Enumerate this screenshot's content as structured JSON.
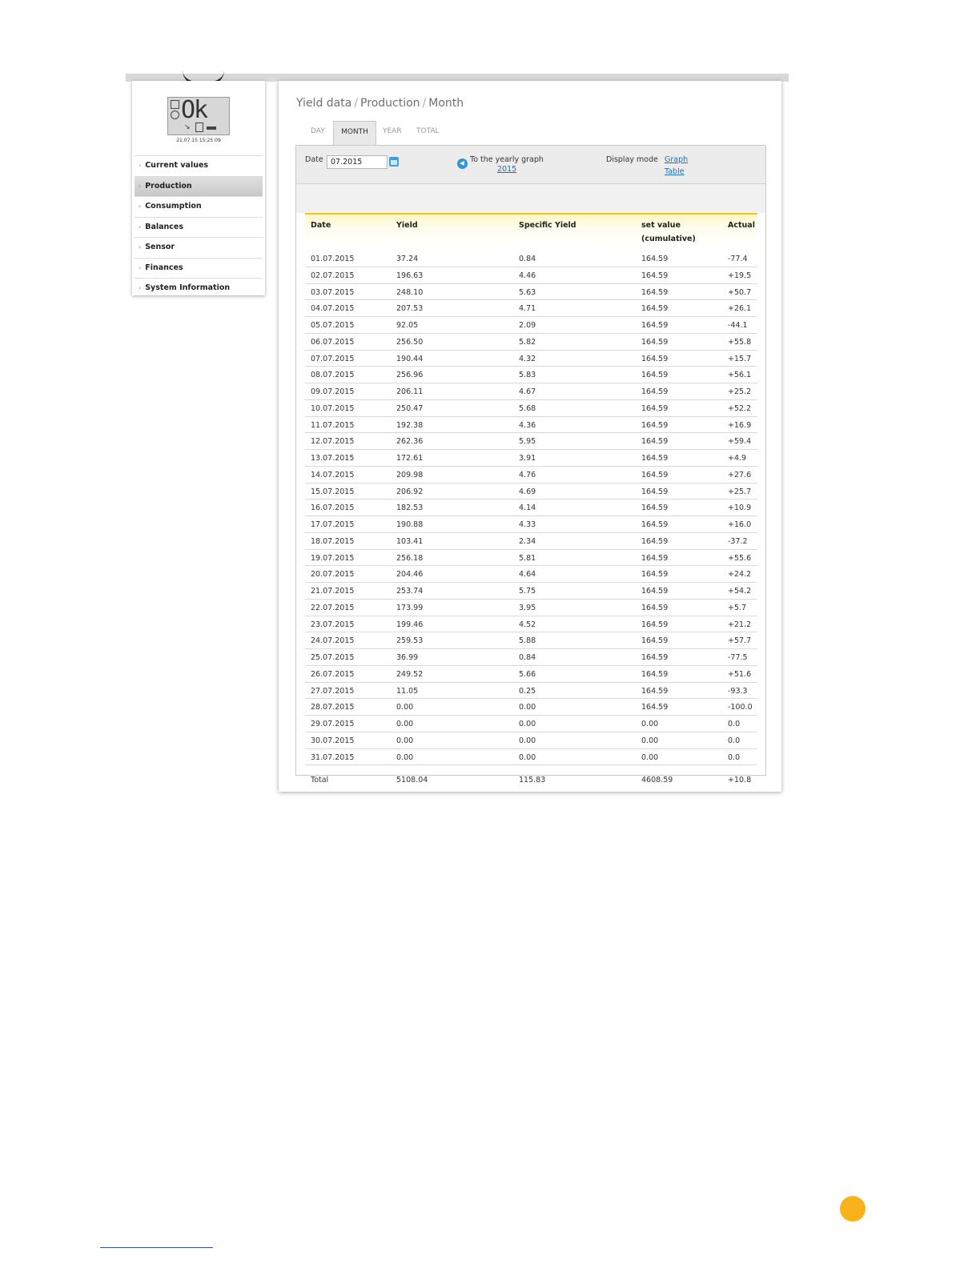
{
  "sidebar": {
    "display_text": "Ok",
    "timestamp": "21.07.15 15:25:09",
    "menu": [
      {
        "label": "Current values"
      },
      {
        "label": "Production",
        "active": true
      },
      {
        "label": "Consumption"
      },
      {
        "label": "Balances"
      },
      {
        "label": "Sensor"
      },
      {
        "label": "Finances"
      },
      {
        "label": "System Information"
      }
    ]
  },
  "main": {
    "breadcrumb": [
      "Yield data",
      "Production",
      "Month"
    ],
    "tabs": [
      {
        "label": "DAY"
      },
      {
        "label": "MONTH",
        "active": true
      },
      {
        "label": "YEAR"
      },
      {
        "label": "TOTAL"
      }
    ],
    "toolbar": {
      "date_label": "Date",
      "date_value": "07.2015",
      "yearly_link_text": "To the yearly graph",
      "yearly_link_year": "2015",
      "display_mode_label": "Display mode",
      "mode_graph": "Graph",
      "mode_table": "Table"
    },
    "table": {
      "headers": [
        "Date",
        "Yield",
        "Specific Yield",
        "set value",
        "Actual"
      ],
      "header_sub": "(cumulative)",
      "rows": [
        [
          "01.07.2015",
          "37.24",
          "0.84",
          "164.59",
          "-77.4"
        ],
        [
          "02.07.2015",
          "196.63",
          "4.46",
          "164.59",
          "+19.5"
        ],
        [
          "03.07.2015",
          "248.10",
          "5.63",
          "164.59",
          "+50.7"
        ],
        [
          "04.07.2015",
          "207.53",
          "4.71",
          "164.59",
          "+26.1"
        ],
        [
          "05.07.2015",
          "92.05",
          "2.09",
          "164.59",
          "-44.1"
        ],
        [
          "06.07.2015",
          "256.50",
          "5.82",
          "164.59",
          "+55.8"
        ],
        [
          "07.07.2015",
          "190.44",
          "4.32",
          "164.59",
          "+15.7"
        ],
        [
          "08.07.2015",
          "256.96",
          "5.83",
          "164.59",
          "+56.1"
        ],
        [
          "09.07.2015",
          "206.11",
          "4.67",
          "164.59",
          "+25.2"
        ],
        [
          "10.07.2015",
          "250.47",
          "5.68",
          "164.59",
          "+52.2"
        ],
        [
          "11.07.2015",
          "192.38",
          "4.36",
          "164.59",
          "+16.9"
        ],
        [
          "12.07.2015",
          "262.36",
          "5.95",
          "164.59",
          "+59.4"
        ],
        [
          "13.07.2015",
          "172.61",
          "3.91",
          "164.59",
          "+4.9"
        ],
        [
          "14.07.2015",
          "209.98",
          "4.76",
          "164.59",
          "+27.6"
        ],
        [
          "15.07.2015",
          "206.92",
          "4.69",
          "164.59",
          "+25.7"
        ],
        [
          "16.07.2015",
          "182.53",
          "4.14",
          "164.59",
          "+10.9"
        ],
        [
          "17.07.2015",
          "190.88",
          "4.33",
          "164.59",
          "+16.0"
        ],
        [
          "18.07.2015",
          "103.41",
          "2.34",
          "164.59",
          "-37.2"
        ],
        [
          "19.07.2015",
          "256.18",
          "5.81",
          "164.59",
          "+55.6"
        ],
        [
          "20.07.2015",
          "204.46",
          "4.64",
          "164.59",
          "+24.2"
        ],
        [
          "21.07.2015",
          "253.74",
          "5.75",
          "164.59",
          "+54.2"
        ],
        [
          "22.07.2015",
          "173.99",
          "3.95",
          "164.59",
          "+5.7"
        ],
        [
          "23.07.2015",
          "199.46",
          "4.52",
          "164.59",
          "+21.2"
        ],
        [
          "24.07.2015",
          "259.53",
          "5.88",
          "164.59",
          "+57.7"
        ],
        [
          "25.07.2015",
          "36.99",
          "0.84",
          "164.59",
          "-77.5"
        ],
        [
          "26.07.2015",
          "249.52",
          "5.66",
          "164.59",
          "+51.6"
        ],
        [
          "27.07.2015",
          "11.05",
          "0.25",
          "164.59",
          "-93.3"
        ],
        [
          "28.07.2015",
          "0.00",
          "0.00",
          "164.59",
          "-100.0"
        ],
        [
          "29.07.2015",
          "0.00",
          "0.00",
          "0.00",
          "0.0"
        ],
        [
          "30.07.2015",
          "0.00",
          "0.00",
          "0.00",
          "0.0"
        ],
        [
          "31.07.2015",
          "0.00",
          "0.00",
          "0.00",
          "0.0"
        ]
      ],
      "total": [
        "Total",
        "5108.04",
        "115.83",
        "4608.59",
        "+10.8"
      ]
    }
  },
  "colors": {
    "accent_yellow": "#f0c419",
    "link_blue": "#1f6fb5",
    "orange_dot": "#f9b21a"
  }
}
